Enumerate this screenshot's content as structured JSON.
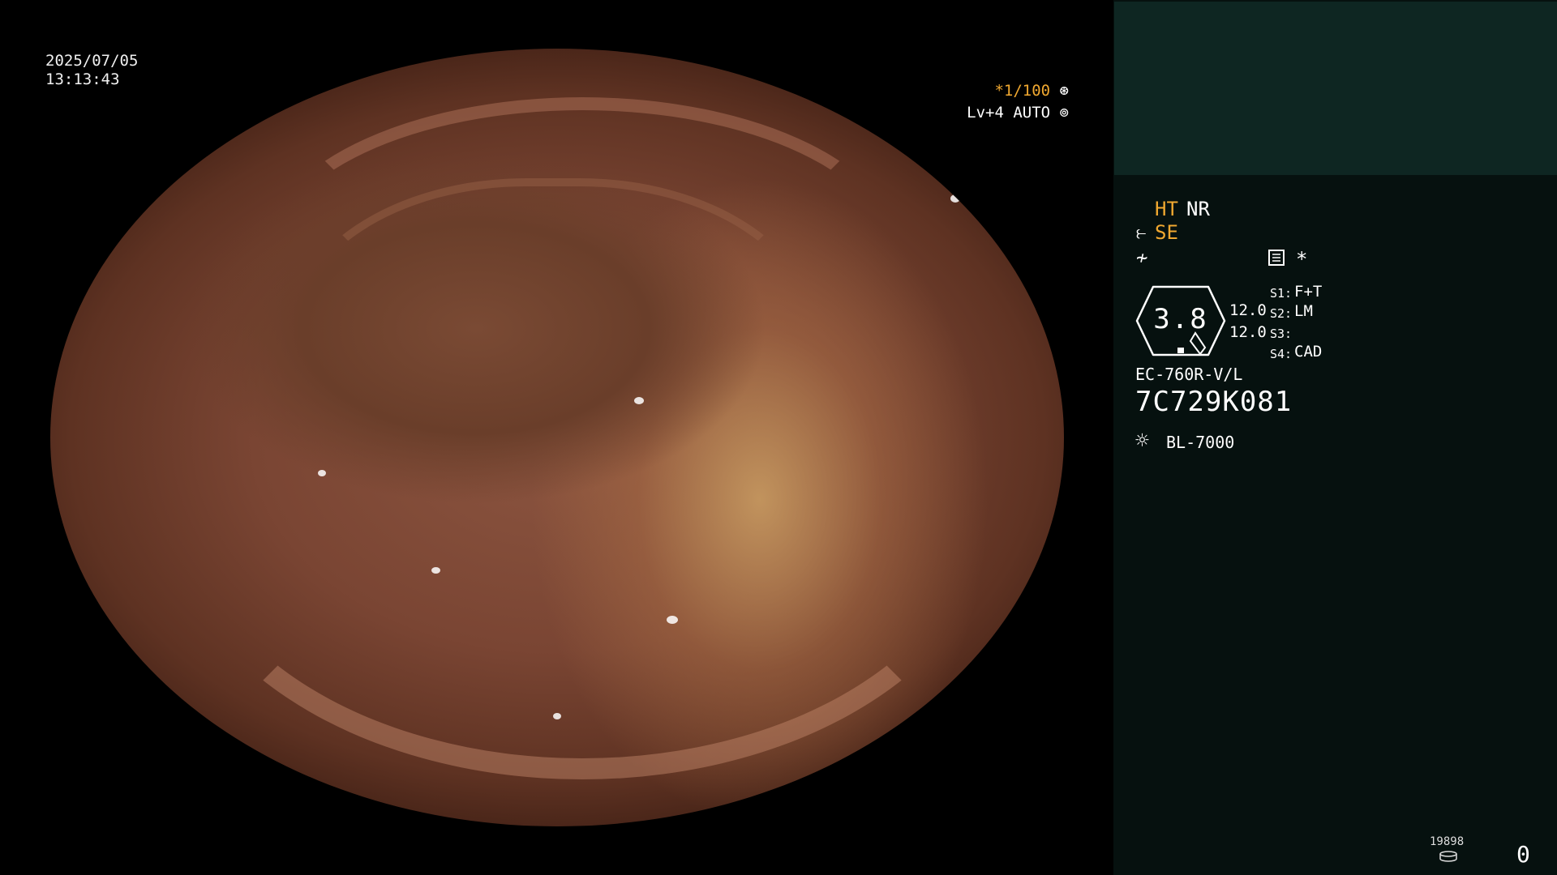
{
  "osd": {
    "date": "2025/07/05",
    "time": "13:13:43",
    "shutter": "*1/100",
    "shutter_icon": "shutter-icon",
    "level_mode": "Lv+4 AUTO",
    "level_icon": "iris-icon"
  },
  "panel": {
    "ht": "HT",
    "nr": "NR",
    "se": "SE",
    "se_icon": "structure-enhancement-icon",
    "flash_icon": "flash-off-icon",
    "doc_icon": "document-icon",
    "star": "*",
    "dial_value": "3.8",
    "value_1": "12.0",
    "value_2": "12.0",
    "switches": [
      {
        "label": "S1:",
        "value": "F+T"
      },
      {
        "label": "S2:",
        "value": "LM"
      },
      {
        "label": "S3:",
        "value": ""
      },
      {
        "label": "S4:",
        "value": "CAD"
      }
    ],
    "scope_model": "EC-760R-V/L",
    "scope_serial": "7C729K081",
    "light_icon": "light-source-icon",
    "light_source": "BL-7000",
    "storage_count": "19898",
    "storage_icon": "disk-icon",
    "image_count": "0"
  },
  "colors": {
    "accent_orange": "#f0a830",
    "panel_bg": "#06110f",
    "panel_top_bg": "#0e2622",
    "text": "#ffffff"
  }
}
